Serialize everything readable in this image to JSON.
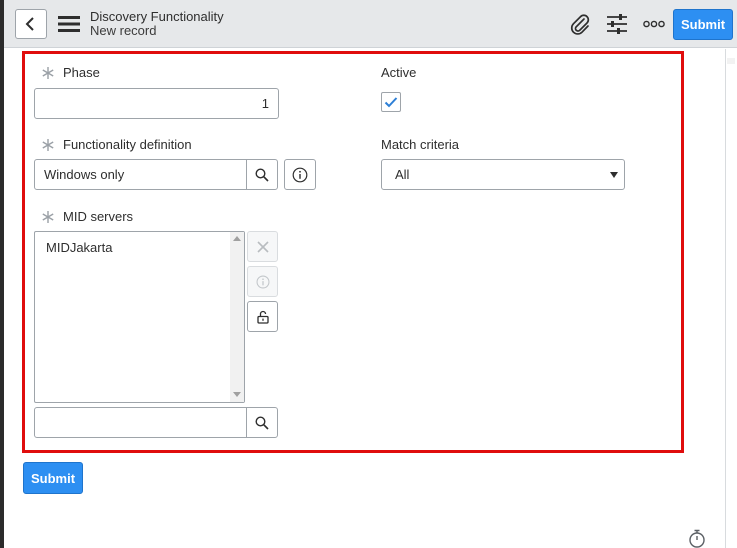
{
  "header": {
    "title": "Discovery Functionality",
    "subtitle": "New record",
    "submit_label": "Submit",
    "icons": [
      "back-icon",
      "menu-icon",
      "paperclip-icon",
      "sliders-icon",
      "more-icon"
    ]
  },
  "form": {
    "phase": {
      "label": "Phase",
      "value": "1",
      "required": true
    },
    "active": {
      "label": "Active",
      "checked": true
    },
    "functionality_definition": {
      "label": "Functionality definition",
      "value": "Windows only",
      "required": true
    },
    "match_criteria": {
      "label": "Match criteria",
      "selected": "All"
    },
    "mid_servers": {
      "label": "MID servers",
      "items": [
        "MIDJakarta"
      ],
      "required": true,
      "search_value": ""
    }
  },
  "footer": {
    "submit_label": "Submit"
  },
  "colors": {
    "accent": "#2d8ff2",
    "highlight": "#e00d0d",
    "header_bg": "#e6e8ea"
  }
}
